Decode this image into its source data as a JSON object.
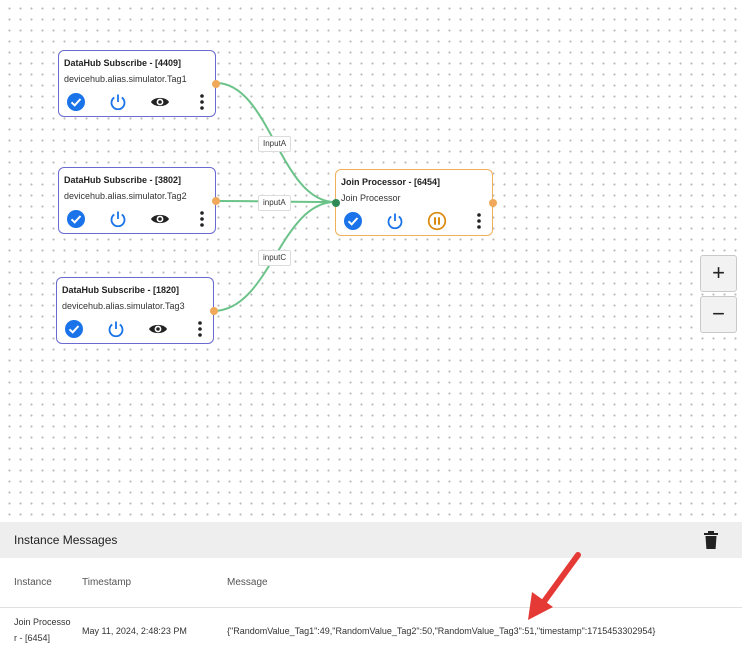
{
  "nodes": [
    {
      "title": "DataHub Subscribe - [4409]",
      "subtitle": "devicehub.alias.simulator.Tag1"
    },
    {
      "title": "DataHub Subscribe - [3802]",
      "subtitle": "devicehub.alias.simulator.Tag2"
    },
    {
      "title": "DataHub Subscribe - [1820]",
      "subtitle": "devicehub.alias.simulator.Tag3"
    },
    {
      "title": "Join Processor - [6454]",
      "subtitle": "Join Processor"
    }
  ],
  "links": [
    {
      "label": "InputA"
    },
    {
      "label": "inputA"
    },
    {
      "label": "inputC"
    }
  ],
  "zoom": {
    "in_label": "+",
    "out_label": "−"
  },
  "panel": {
    "title": "Instance Messages",
    "columns": {
      "instance": "Instance",
      "timestamp": "Timestamp",
      "message": "Message"
    },
    "rows": [
      {
        "instance_line1": "Join Processo",
        "instance_line2": "r - [6454]",
        "timestamp": "May 11, 2024, 2:48:23 PM",
        "message": "{\"RandomValue_Tag1\":49,\"RandomValue_Tag2\":50,\"RandomValue_Tag3\":51,\"timestamp\":1715453302954}"
      }
    ]
  },
  "colors": {
    "accent_blue": "#1a73e8",
    "node_border": "#6a6ad0",
    "join_border": "#f0b05a",
    "link_green": "#6cc38a",
    "arrow_red": "#e53935",
    "pause_orange": "#d98a10"
  },
  "icons": [
    "check-circle-icon",
    "power-icon",
    "eye-icon",
    "more-vert-icon",
    "pause-circle-icon",
    "trash-icon",
    "arrow-annotation"
  ]
}
